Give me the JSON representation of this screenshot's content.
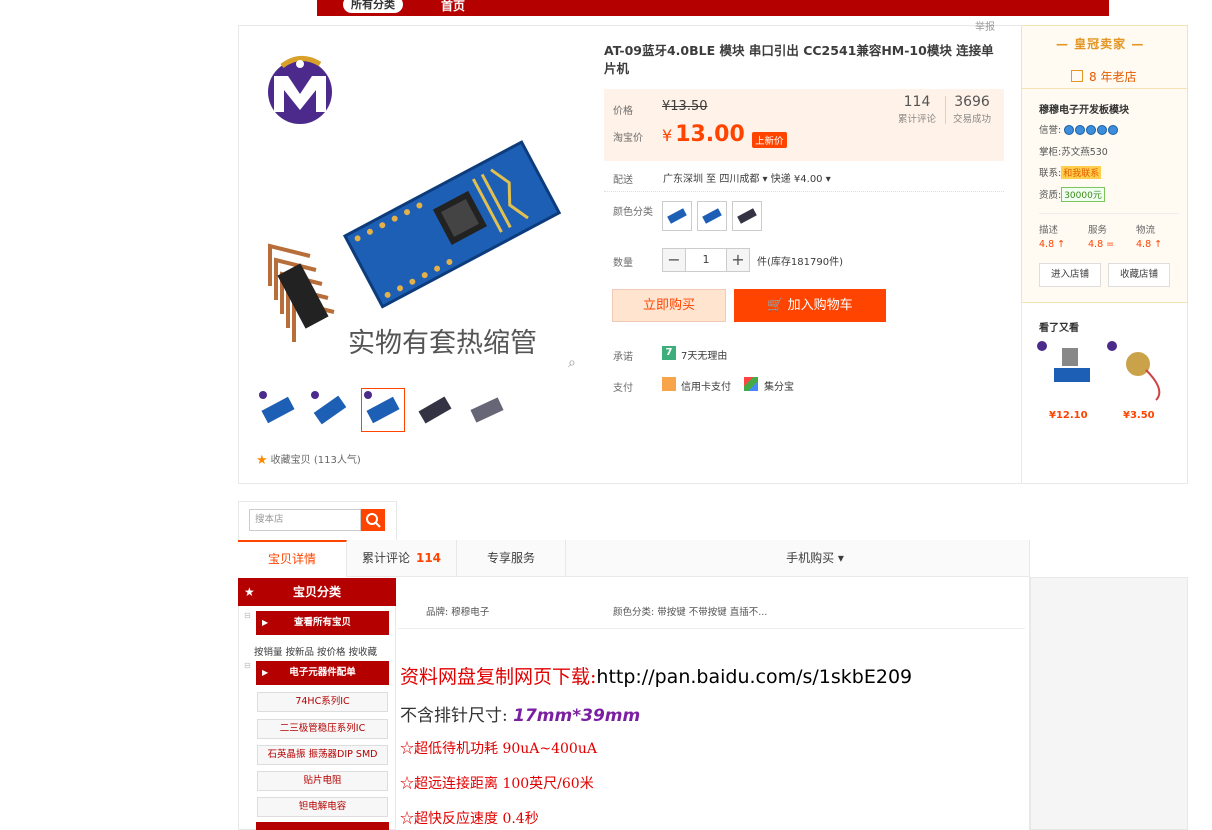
{
  "topnav": {
    "all_categories": "所有分类",
    "home": "首页"
  },
  "product": {
    "report": "举报",
    "title": "AT-09蓝牙4.0BLE 模块 串口引出 CC2541兼容HM-10模块 连接单片机",
    "image_caption": "实物有套热缩管",
    "price_label": "价格",
    "old_price": "¥13.50",
    "taobao_price_label": "淘宝价",
    "yen": "¥",
    "taobao_price": "13.00",
    "badge": "上新价",
    "reviews_count": "114",
    "reviews_label": "累计评论",
    "sold_count": "3696",
    "sold_label": "交易成功",
    "ship_label": "配送",
    "ship_value": "广东深圳 至 四川成都 ▾    快递 ¥4.00 ▾",
    "color_label": "颜色分类",
    "qty_label": "数量",
    "qty_minus": "−",
    "qty_value": "1",
    "qty_plus": "+",
    "stock": "件(库存181790件)",
    "buy_now": "立即购买",
    "add_cart": "加入购物车",
    "promise_label": "承诺",
    "promise_icon_text": "7",
    "promise_value": "7天无理由",
    "pay_label": "支付",
    "pay_credit": "信用卡支付",
    "pay_installment": "集分宝",
    "favorite": "收藏宝贝 (113人气)"
  },
  "seller": {
    "crown": "— 皇冠卖家 —",
    "age": "8 年老店",
    "shop_name": "穆穆电子开发板模块",
    "credit_label": "信誉:",
    "keeper_label": "掌柜:",
    "keeper": "苏文燕530",
    "contact_label": "联系:",
    "contact_btn": "和我联系",
    "deposit_label": "资质:",
    "deposit": "30000元",
    "rates": [
      {
        "label": "描述",
        "value": "4.8 ↑"
      },
      {
        "label": "服务",
        "value": "4.8 ="
      },
      {
        "label": "物流",
        "value": "4.8 ↑"
      }
    ],
    "enter_shop": "进入店铺",
    "fav_shop": "收藏店铺",
    "seen_title": "看了又看",
    "seen_prices": [
      "¥12.10",
      "¥3.50"
    ]
  },
  "search": {
    "placeholder": "搜本店"
  },
  "tabs": {
    "detail": "宝贝详情",
    "reviews": "累计评论",
    "reviews_count": "114",
    "service": "专享服务",
    "mobile": "手机购买 ▾"
  },
  "categories": {
    "header": "宝贝分类",
    "view_all": "查看所有宝贝",
    "sort_links": "按销量 按新品 按价格 按收藏",
    "electronics": "电子元器件配单",
    "items": [
      "74HC系列IC",
      "二三极管稳压系列IC",
      "石英晶振 振荡器DIP SMD",
      "贴片电阻",
      "钽电解电容"
    ]
  },
  "detail": {
    "brand": "品牌: 穆穆电子",
    "color_class": "颜色分类: 带按键 不带按键 直插不...",
    "download_label": "资料网盘复制网页下载:",
    "download_url": "http://pan.baidu.com/s/1skbE209",
    "size_label": "不含排针尺寸:",
    "size_value": "17mm*39mm",
    "feature1": "☆超低待机功耗 90uA~400uA",
    "feature2": "☆超远连接距离 100英尺/60米",
    "feature3": "☆超快反应速度 0.4秒"
  },
  "colors": {
    "brand_red": "#b50000",
    "accent": "#ff4400",
    "price_bg": "#fff2e8",
    "pcb_blue": "#1d5fb4"
  }
}
